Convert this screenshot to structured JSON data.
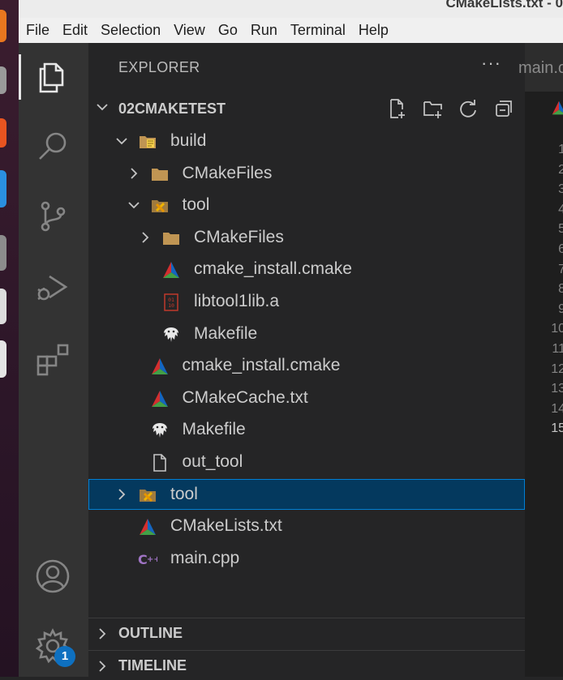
{
  "window": {
    "title": "CMakeLists.txt - 0"
  },
  "menu": [
    "File",
    "Edit",
    "Selection",
    "View",
    "Go",
    "Run",
    "Terminal",
    "Help"
  ],
  "activity": {
    "items": [
      "explorer",
      "search",
      "source-control",
      "run-and-debug",
      "extensions"
    ],
    "bottom": [
      "accounts",
      "manage"
    ],
    "manage_badge": "1"
  },
  "sidebar": {
    "title": "EXPLORER",
    "more": "···",
    "section": "02CMAKETEST",
    "tree": [
      {
        "label": "build",
        "depth": 0,
        "kind": "folder-build",
        "state": "expanded"
      },
      {
        "label": "CMakeFiles",
        "depth": 1,
        "kind": "folder",
        "state": "collapsed"
      },
      {
        "label": "tool",
        "depth": 1,
        "kind": "folder-tool",
        "state": "expanded"
      },
      {
        "label": "CMakeFiles",
        "depth": 2,
        "kind": "folder",
        "state": "collapsed"
      },
      {
        "label": "cmake_install.cmake",
        "depth": 2,
        "kind": "cmake"
      },
      {
        "label": "libtool1lib.a",
        "depth": 2,
        "kind": "binary"
      },
      {
        "label": "Makefile",
        "depth": 2,
        "kind": "makefile"
      },
      {
        "label": "cmake_install.cmake",
        "depth": 1,
        "kind": "cmake"
      },
      {
        "label": "CMakeCache.txt",
        "depth": 1,
        "kind": "cmake"
      },
      {
        "label": "Makefile",
        "depth": 1,
        "kind": "makefile"
      },
      {
        "label": "out_tool",
        "depth": 1,
        "kind": "file"
      },
      {
        "label": "tool",
        "depth": 0,
        "kind": "folder-tool",
        "state": "collapsed",
        "selected": true
      },
      {
        "label": "CMakeLists.txt",
        "depth": 0,
        "kind": "cmake"
      },
      {
        "label": "main.cpp",
        "depth": 0,
        "kind": "cpp"
      }
    ],
    "outline": "OUTLINE",
    "timeline": "TIMELINE"
  },
  "editor": {
    "tab": "main.cp",
    "line_numbers": [
      "1",
      "2",
      "3",
      "4",
      "5",
      "6",
      "7",
      "8",
      "9",
      "10",
      "11",
      "12",
      "13",
      "14",
      "15"
    ]
  },
  "colors": {
    "accent": "#007fd4",
    "selection": "#04395e",
    "badge": "#0e70c0"
  }
}
